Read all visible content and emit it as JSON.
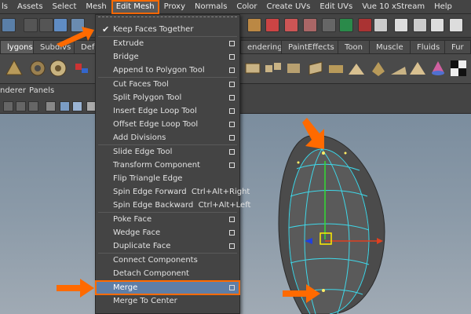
{
  "menubar": {
    "items": [
      "ls",
      "Assets",
      "Select",
      "Mesh",
      "Edit Mesh",
      "Proxy",
      "Normals",
      "Color",
      "Create UVs",
      "Edit UVs",
      "Vue 10 xStream",
      "Help"
    ]
  },
  "shelf_tabs": [
    "lygons",
    "Subdivs",
    "Defo",
    "endering",
    "PaintEffects",
    "Toon",
    "Muscle",
    "Fluids",
    "Fur"
  ],
  "panel_menu": [
    "nderer",
    "Panels"
  ],
  "edit_mesh_menu": {
    "items": [
      {
        "label": "Keep Faces Together",
        "checked": true,
        "option_box": false
      },
      {
        "label": "Extrude",
        "option_box": true
      },
      {
        "label": "Bridge",
        "option_box": true
      },
      {
        "label": "Append to Polygon Tool",
        "option_box": true
      },
      {
        "label": "Cut Faces Tool",
        "option_box": true
      },
      {
        "label": "Split Polygon Tool",
        "option_box": true
      },
      {
        "label": "Insert Edge Loop Tool",
        "option_box": true
      },
      {
        "label": "Offset Edge Loop Tool",
        "option_box": true
      },
      {
        "label": "Add Divisions",
        "option_box": true
      },
      {
        "label": "Slide Edge Tool",
        "option_box": true
      },
      {
        "label": "Transform Component",
        "option_box": true
      },
      {
        "label": "Flip Triangle Edge",
        "option_box": false
      },
      {
        "label": "Spin Edge Forward",
        "shortcut": "Ctrl+Alt+Right",
        "option_box": false
      },
      {
        "label": "Spin Edge Backward",
        "shortcut": "Ctrl+Alt+Left",
        "option_box": false
      },
      {
        "label": "Poke Face",
        "option_box": true
      },
      {
        "label": "Wedge Face",
        "option_box": true
      },
      {
        "label": "Duplicate Face",
        "option_box": true
      },
      {
        "label": "Connect Components",
        "option_box": false
      },
      {
        "label": "Detach Component",
        "option_box": false
      },
      {
        "label": "Merge",
        "option_box": true,
        "highlighted": true
      },
      {
        "label": "Merge To Center",
        "option_box": false
      }
    ]
  },
  "colors": {
    "highlight_outline": "#ff6a00",
    "menu_bg": "#444444",
    "selected_row": "#5f7ea6",
    "mesh_wire": "#3fd7e8",
    "viewport_sky": "#8b9aa8"
  }
}
